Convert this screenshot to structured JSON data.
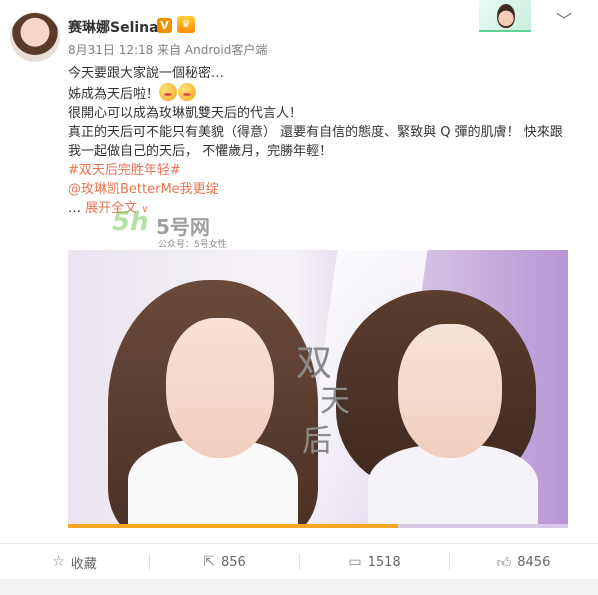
{
  "post": {
    "user_name": "赛琳娜Selina",
    "verified_badge": "V",
    "vip_icon": "crown-icon",
    "meta": "8月31日 12:18 来自 Android客户端",
    "line1": "今天要跟大家說一個秘密…",
    "line2": "姊成為天后啦！",
    "line3": "很開心可以成為玫琳凱雙天后的代言人！",
    "line4": "真正的天后可不能只有美貌（得意） 還要有自信的態度、緊致與 Q 彈的肌膚！  快來跟我一起做自己的天后， 不懼歲月，完勝年輕！",
    "topic": "#双天后完胜年轻#",
    "mention": "@玫琳凯BetterMe我更绽",
    "ellipsis": "…",
    "expand": "展开全文",
    "expand_arrow": "∨"
  },
  "watermark": {
    "logo": "5h",
    "title": "5号网",
    "subtitle": "公众号：5号女性"
  },
  "media": {
    "ad_text": [
      "双",
      "天",
      "后"
    ],
    "progress": 0.66
  },
  "actions": {
    "favorite": {
      "icon": "star-icon",
      "label": "收藏"
    },
    "repost": {
      "icon": "repost-icon",
      "count": "856"
    },
    "comment": {
      "icon": "comment-icon",
      "count": "1518"
    },
    "like": {
      "icon": "thumbs-up-icon",
      "count": "8456"
    }
  },
  "colors": {
    "link": "#eb7350",
    "vip_badge": "#f29100",
    "text": "#333333",
    "meta": "#808080"
  }
}
